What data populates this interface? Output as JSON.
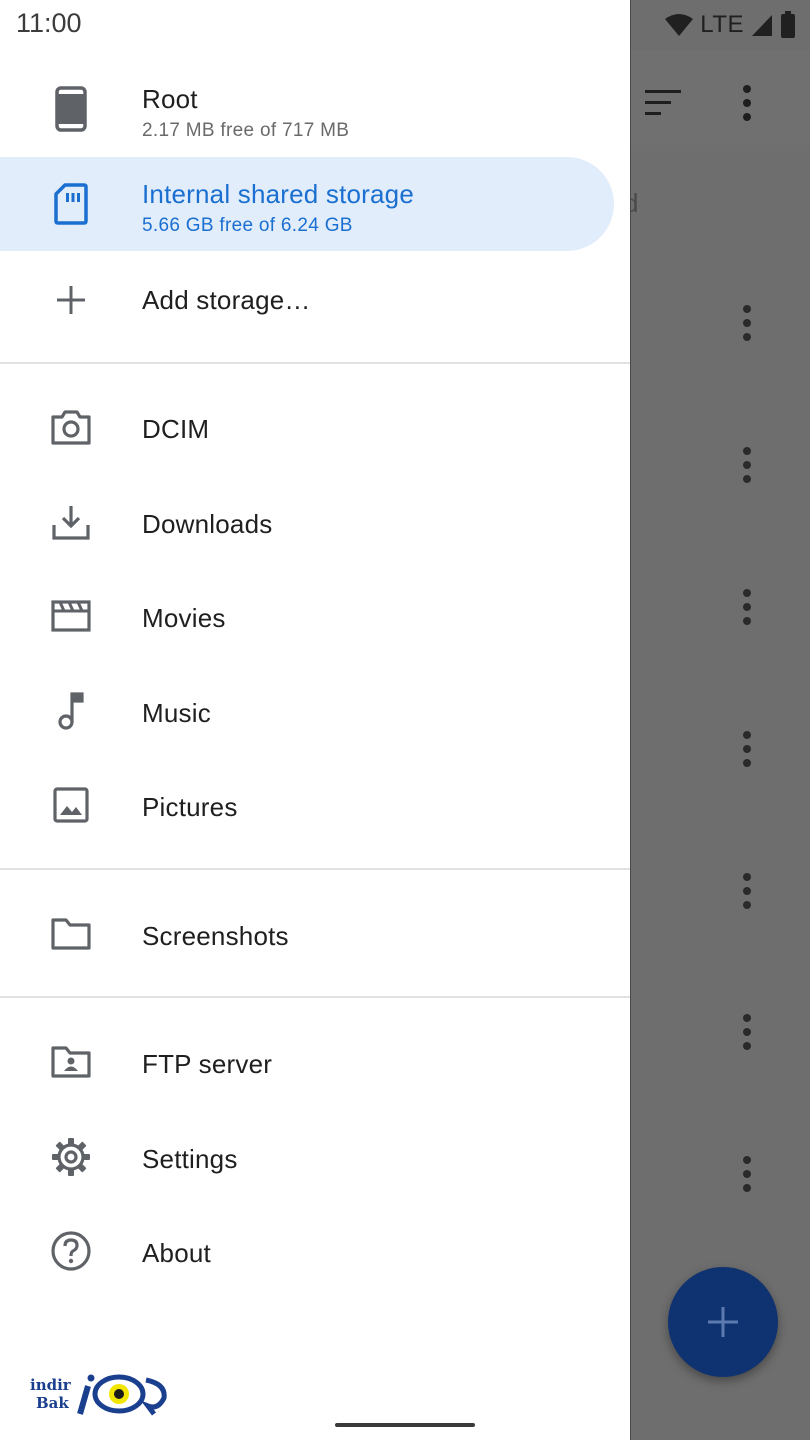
{
  "status_bar": {
    "time": "11:00",
    "network": "LTE"
  },
  "drawer": {
    "storage": [
      {
        "label": "Root",
        "subtitle": "2.17 MB free of 717 MB",
        "icon": "phone-icon"
      },
      {
        "label": "Internal shared storage",
        "subtitle": "5.66 GB free of 6.24 GB",
        "icon": "sd-card-icon",
        "selected": true
      },
      {
        "label": "Add storage…",
        "icon": "plus-icon"
      }
    ],
    "folders": [
      {
        "label": "DCIM",
        "icon": "camera-icon"
      },
      {
        "label": "Downloads",
        "icon": "download-icon"
      },
      {
        "label": "Movies",
        "icon": "movie-icon"
      },
      {
        "label": "Music",
        "icon": "music-note-icon"
      },
      {
        "label": "Pictures",
        "icon": "image-icon"
      }
    ],
    "bookmarks": [
      {
        "label": "Screenshots",
        "icon": "folder-icon"
      }
    ],
    "app": [
      {
        "label": "FTP server",
        "icon": "shared-folder-icon"
      },
      {
        "label": "Settings",
        "icon": "gear-icon"
      },
      {
        "label": "About",
        "icon": "help-icon"
      }
    ]
  },
  "background": {
    "partial_text": "d"
  },
  "watermark": {
    "line1": "indir",
    "line2": "Bak"
  },
  "colors": {
    "accent": "#1a6fd0",
    "selected_bg": "#e1edfb",
    "fab": "#0f3270",
    "scrim": "#6e6e6e"
  }
}
